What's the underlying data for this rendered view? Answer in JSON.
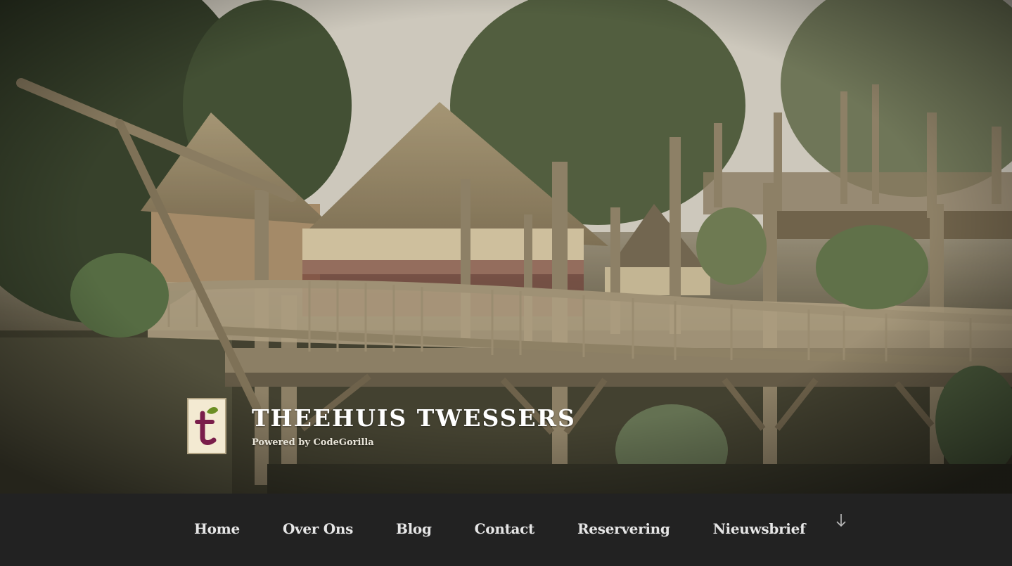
{
  "site": {
    "title": "Theehuis Twessers",
    "tagline": "Powered by CodeGorilla",
    "logo_letter": "t",
    "logo_color": "#7a1e4a",
    "logo_leaf_color": "#6b8e23"
  },
  "hero": {
    "icon": "hero-photo-treehouse"
  },
  "nav": {
    "items": [
      {
        "label": "Home"
      },
      {
        "label": "Over Ons"
      },
      {
        "label": "Blog"
      },
      {
        "label": "Contact"
      },
      {
        "label": "Reservering"
      },
      {
        "label": "Nieuwsbrief"
      }
    ],
    "scroll_icon": "arrow-down-icon"
  },
  "colors": {
    "nav_background": "#222222",
    "nav_text": "#e6e6e6",
    "title_text": "#ffffff"
  }
}
